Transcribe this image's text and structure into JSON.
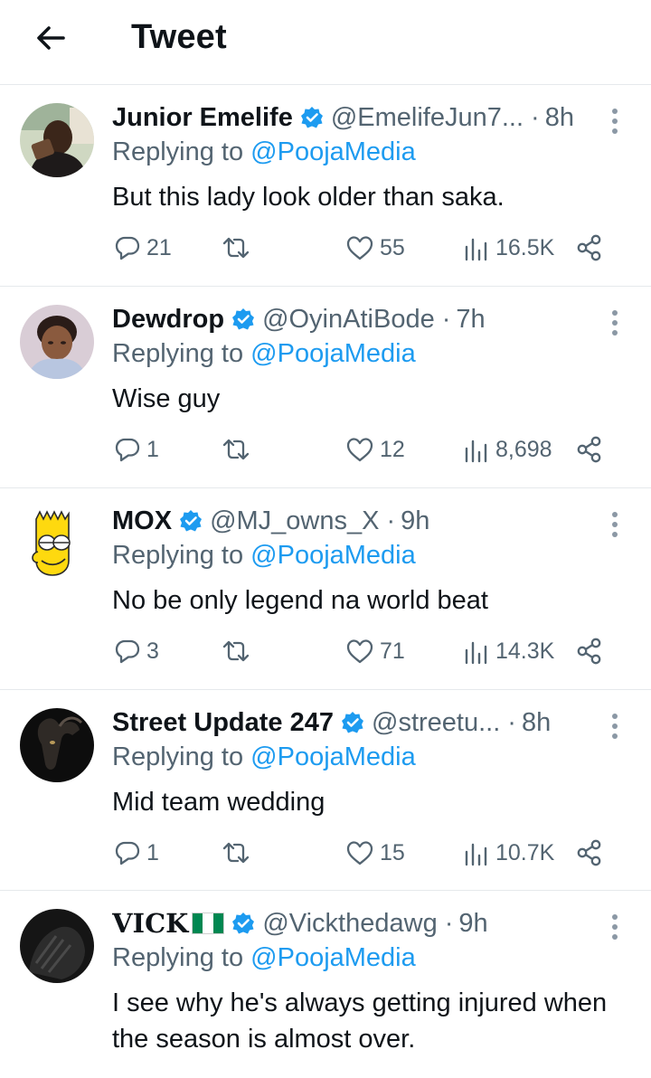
{
  "header": {
    "title": "Tweet",
    "back_icon": "arrow-left-icon"
  },
  "colors": {
    "link": "#1d9bf0",
    "muted": "#536471",
    "verified": "#1d9bf0",
    "text": "#0f1419"
  },
  "tweets": [
    {
      "name": "Junior Emelife",
      "handle": "@EmelifeJun7...",
      "dot": "·",
      "time": "8h",
      "reply_prefix": "Replying to",
      "reply_to": "@PoojaMedia",
      "text": "But this lady look older than saka.",
      "replies": "21",
      "likes": "55",
      "views": "16.5K"
    },
    {
      "name": "Dewdrop",
      "handle": "@OyinAtiBode",
      "dot": "·",
      "time": "7h",
      "reply_prefix": "Replying to",
      "reply_to": "@PoojaMedia",
      "text": "Wise guy",
      "replies": "1",
      "likes": "12",
      "views": "8,698"
    },
    {
      "name": "MOX",
      "handle": "@MJ_owns_X",
      "dot": "·",
      "time": "9h",
      "reply_prefix": "Replying to",
      "reply_to": "@PoojaMedia",
      "text": "No be only legend na world beat",
      "replies": "3",
      "likes": "71",
      "views": "14.3K"
    },
    {
      "name": "Street Update 247",
      "handle": "@streetu...",
      "dot": "·",
      "time": "8h",
      "reply_prefix": "Replying to",
      "reply_to": "@PoojaMedia",
      "text": "Mid team wedding",
      "replies": "1",
      "likes": "15",
      "views": "10.7K"
    },
    {
      "name": "VICK",
      "handle": "@Vickthedawg",
      "dot": "·",
      "time": "9h",
      "reply_prefix": "Replying to",
      "reply_to": "@PoojaMedia",
      "text": "I see why he's always getting injured when the season is almost over."
    }
  ]
}
